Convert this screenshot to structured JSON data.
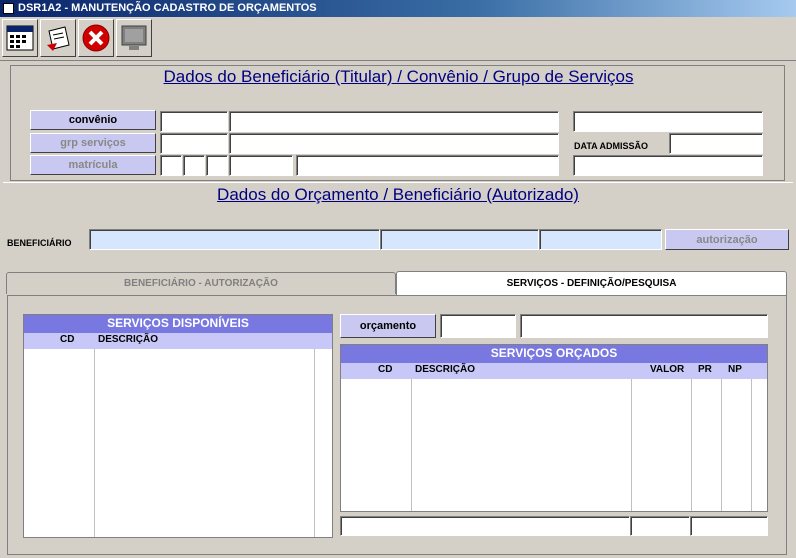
{
  "window": {
    "title": "DSR1A2 - MANUTENÇÃO CADASTRO DE ORÇAMENTOS"
  },
  "toolbar": {
    "buttons": [
      "form-icon",
      "edit-icon",
      "cancel-icon",
      "monitor-icon"
    ]
  },
  "top_section": {
    "title": "Dados do Beneficiário (Titular) / Convênio / Grupo de Serviços",
    "convenio_label": "convênio",
    "grp_servicos_label": "grp serviços",
    "matricula_label": "matrícula",
    "data_admissao_label": "DATA ADMISSÃO"
  },
  "mid_section": {
    "title": "Dados do Orçamento / Beneficiário (Autorizado)",
    "beneficiario_label": "BENEFICIÁRIO",
    "autorizacao_label": "autorização"
  },
  "tabs": [
    {
      "label": "BENEFICIÁRIO - AUTORIZAÇÃO",
      "active": false
    },
    {
      "label": "SERVIÇOS - DEFINIÇÃO/PESQUISA",
      "active": true
    }
  ],
  "servicos_disponiveis": {
    "title": "SERVIÇOS DISPONÍVEIS",
    "col_cd": "CD",
    "col_descricao": "DESCRIÇÃO"
  },
  "orcamento_label": "orçamento",
  "servicos_orcados": {
    "title": "SERVIÇOS ORÇADOS",
    "col_cd": "CD",
    "col_descricao": "DESCRIÇÃO",
    "col_valor": "VALOR",
    "col_pr": "PR",
    "col_np": "NP"
  }
}
